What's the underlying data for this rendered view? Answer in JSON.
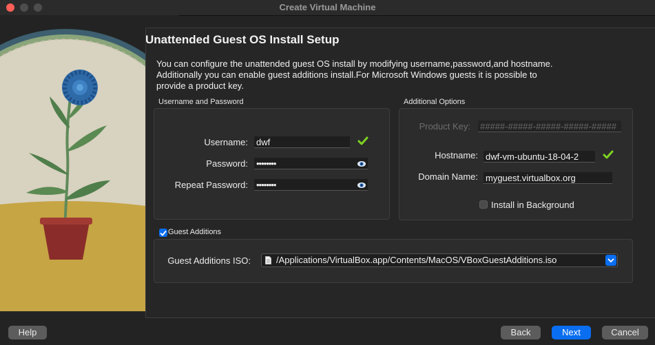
{
  "window": {
    "title": "Create Virtual Machine"
  },
  "heading": "Unattended Guest OS Install Setup",
  "description": [
    "You can configure the unattended guest OS install by modifying username,password,and hostname.",
    "Additionally you can enable guest additions install.For Microsoft Windows guests it is possible to",
    "provide a product key."
  ],
  "credentials": {
    "group_label": "Username and Password",
    "username_label": "Username:",
    "username_value": "dwf",
    "password_label": "Password:",
    "password_value": "••••••••",
    "repeat_label": "Repeat Password:",
    "repeat_value": "••••••••"
  },
  "options": {
    "group_label": "Additional Options",
    "product_key_label": "Product Key:",
    "product_key_value": "#####-#####-#####-#####-#####",
    "hostname_label": "Hostname:",
    "hostname_value": "dwf-vm-ubuntu-18-04-2",
    "domain_label": "Domain Name:",
    "domain_value": "myguest.virtualbox.org",
    "install_bg_label": "Install in Background",
    "install_bg_checked": false
  },
  "guest_additions": {
    "checkbox_label": "Guest Additions",
    "checked": true,
    "iso_label": "Guest Additions ISO:",
    "iso_path": "/Applications/VirtualBox.app/Contents/MacOS/VBoxGuestAdditions.iso"
  },
  "buttons": {
    "help": "Help",
    "back": "Back",
    "next": "Next",
    "cancel": "Cancel"
  },
  "colors": {
    "accent": "#0a6ef0",
    "valid_check": "#7ed321"
  }
}
